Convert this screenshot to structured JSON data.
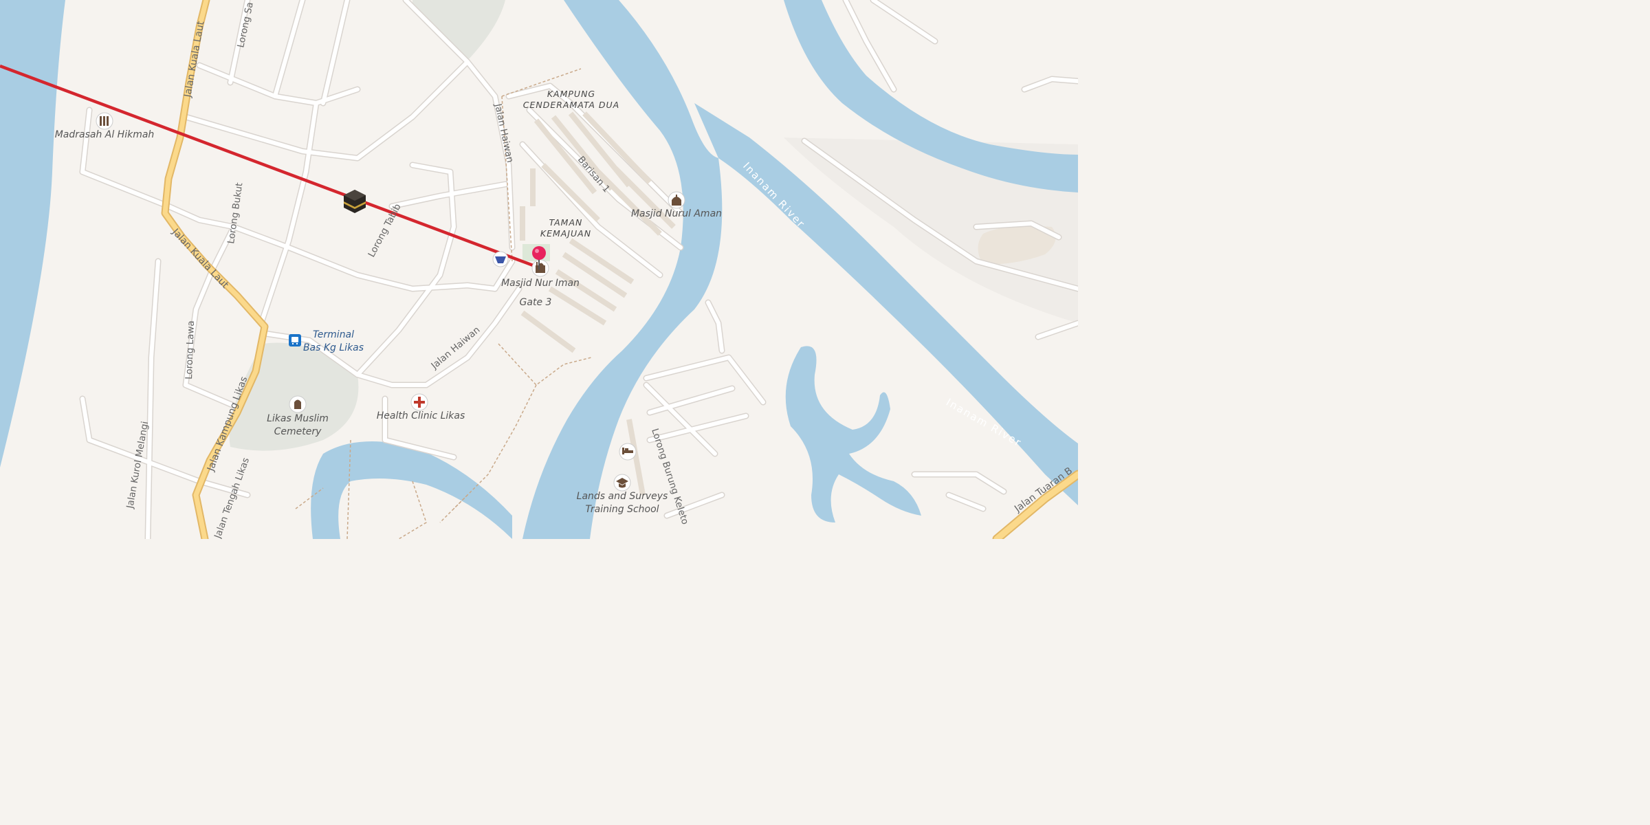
{
  "map": {
    "colors": {
      "land": "#f6f3ef",
      "water": "#a9cde3",
      "road": "#ffffff",
      "road_casing": "#d9d4cf",
      "major_road": "#fbd98b",
      "major_road_casing": "#e2b766",
      "route_line": "#d4262e",
      "pin": "#e8245d"
    },
    "rivers": [
      {
        "label": "Inanam River"
      },
      {
        "label": "Inanam River"
      }
    ],
    "areas": [
      {
        "line1": "KAMPUNG",
        "line2": "CENDERAMATA DUA"
      },
      {
        "line1": "TAMAN",
        "line2": "KEMAJUAN"
      }
    ],
    "roads": {
      "jalan_kuala_laut_north": "Jalan Kuala Laut",
      "jalan_kuala_laut_south": "Jalan Kuala Laut",
      "lorong_sa": "Lorong Sa",
      "lorong_bukut": "Lorong Bukut",
      "lorong_tabib": "Lorong Tabib",
      "jalan_haiwan_north": "Jalan Haiwan",
      "jalan_haiwan_south": "Jalan Haiwan",
      "barisan_1": "Barisan 1",
      "lorong_lawa": "Lorong Lawa",
      "jalan_kampung_likas": "Jalan Kampung Likas",
      "jalan_kurol_melangi": "Jalan Kurol Melangi",
      "jalan_tengah_likas": "Jalan Tengah Likas",
      "lorong_burung_keleto": "Lorong Burung Keleto",
      "jalan_tuaran": "Jalan Tuaran B"
    },
    "pois": {
      "madrasah": "Madrasah Al Hikmah",
      "masjid_nurul_aman": "Masjid Nurul Aman",
      "masjid_nur_iman": "Masjid Nur Iman",
      "gate": "Gate 3",
      "terminal_line1": "Terminal",
      "terminal_line2": "Bas Kg Likas",
      "cemetery_line1": "Likas Muslim",
      "cemetery_line2": "Cemetery",
      "clinic": "Health Clinic Likas",
      "school_line1": "Lands and Surveys",
      "school_line2": "Training School"
    },
    "icons": {
      "qibla_marker": "kaaba-icon",
      "selected_location": "location-pin-icon",
      "madrasah": "school-building-icon",
      "mosque": "mosque-icon",
      "bus_stop": "bus-stop-icon",
      "cemetery": "cemetery-icon",
      "clinic": "medical-cross-icon",
      "hotel": "bed-icon",
      "school": "graduation-cap-icon",
      "shop": "shopping-basket-icon"
    }
  }
}
